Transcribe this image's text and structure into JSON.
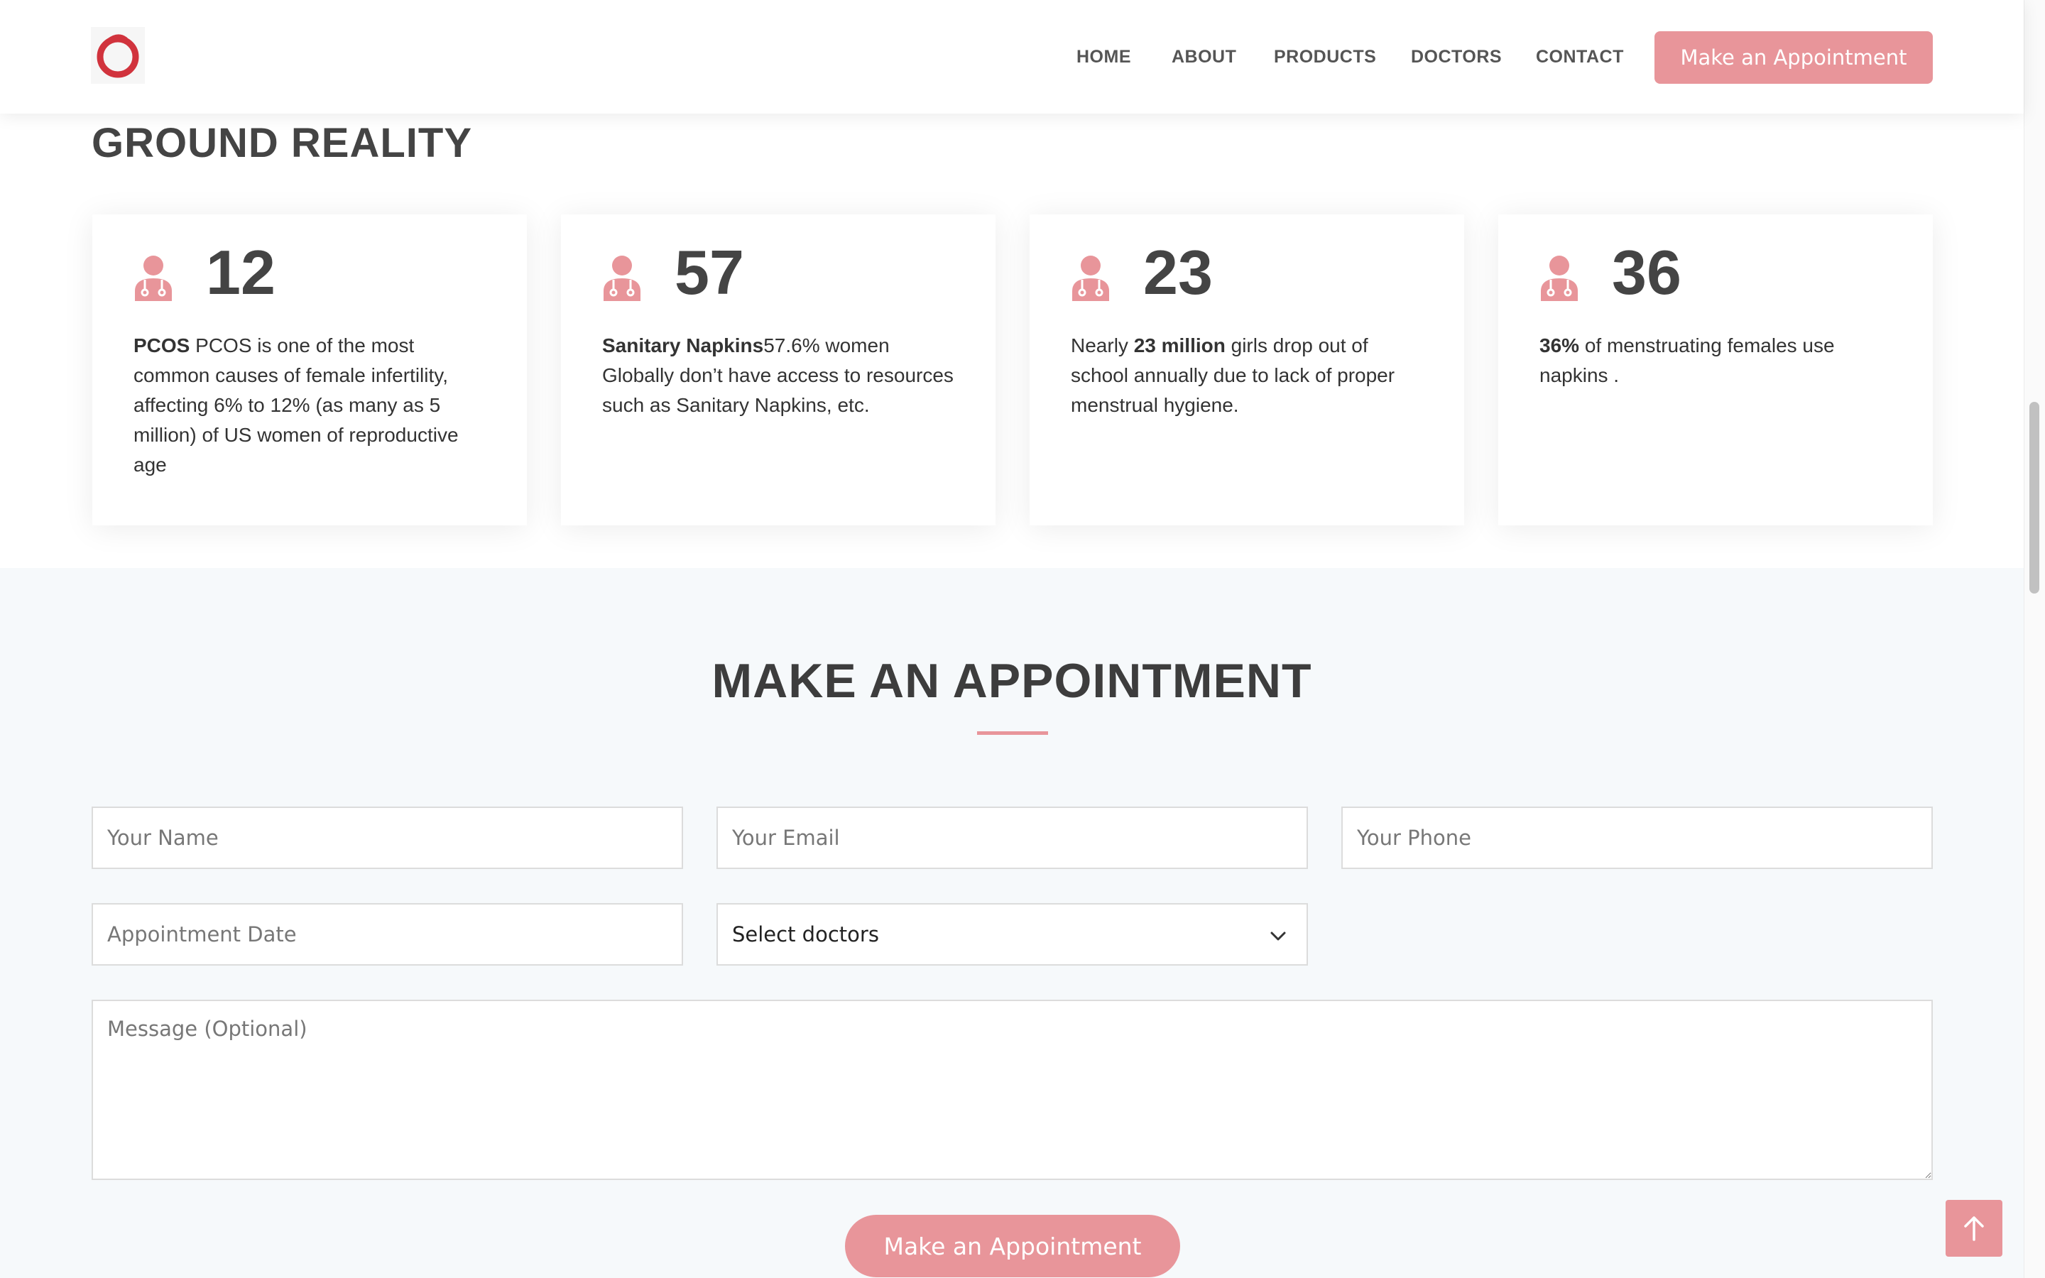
{
  "header": {
    "logo_icon": "red-circle-logo",
    "nav": [
      "HOME",
      "ABOUT",
      "PRODUCTS",
      "DOCTORS",
      "CONTACT"
    ],
    "cta_label": "Make an Appointment",
    "accent_color": "#e8959a"
  },
  "ground_reality": {
    "title": "GROUND REALITY",
    "cards": [
      {
        "icon": "doctor-icon",
        "number": "12",
        "text_parts": [
          {
            "bold": true,
            "text": "PCOS"
          },
          {
            "bold": false,
            "text": " PCOS is one of the most common causes of female infertility, affecting 6% to 12% (as many as 5 million) of US women of reproductive age"
          }
        ]
      },
      {
        "icon": "doctor-icon",
        "number": "57",
        "text_parts": [
          {
            "bold": true,
            "text": "Sanitary Napkins"
          },
          {
            "bold": false,
            "text": "57.6% women Globally don’t have access to resources such as Sanitary Napkins, etc."
          }
        ]
      },
      {
        "icon": "doctor-icon",
        "number": "23",
        "text_parts": [
          {
            "bold": false,
            "text": "Nearly "
          },
          {
            "bold": true,
            "text": "23 million"
          },
          {
            "bold": false,
            "text": " girls drop out of school annually due to lack of proper menstrual hygiene."
          }
        ]
      },
      {
        "icon": "doctor-icon",
        "number": "36",
        "text_parts": [
          {
            "bold": true,
            "text": "36%"
          },
          {
            "bold": false,
            "text": " of menstruating females use napkins ."
          }
        ]
      }
    ]
  },
  "appointment": {
    "title": "MAKE AN APPOINTMENT",
    "name_placeholder": "Your Name",
    "email_placeholder": "Your Email",
    "phone_placeholder": "Your Phone",
    "date_placeholder": "Appointment Date",
    "doctor_select": "Select doctors",
    "message_placeholder": "Message (Optional)",
    "submit_label": "Make an Appointment"
  },
  "back_to_top_icon": "arrow-up-icon"
}
